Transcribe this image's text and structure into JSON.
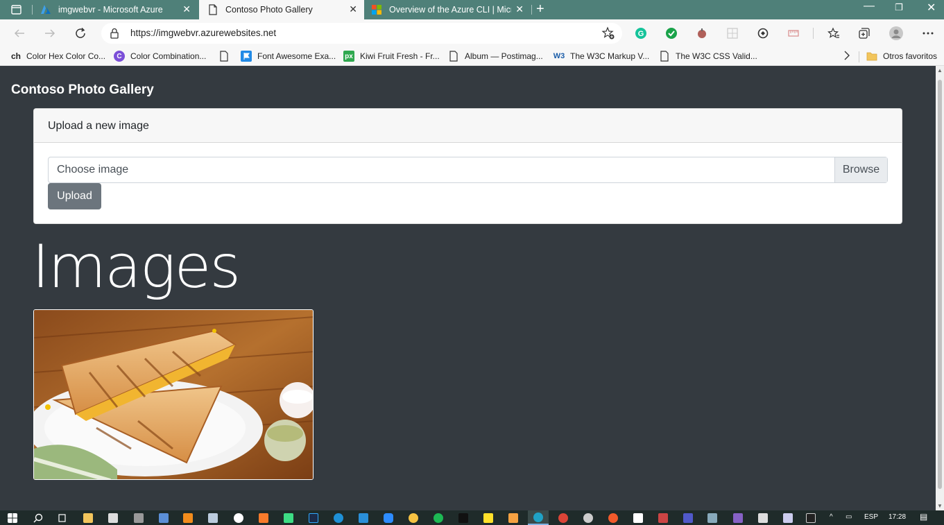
{
  "browser": {
    "tabs": [
      {
        "title": "imgwebvr - Microsoft Azure",
        "active": false
      },
      {
        "title": "Contoso Photo Gallery",
        "active": true
      },
      {
        "title": "Overview of the Azure CLI | Micro",
        "active": false
      }
    ],
    "url": "https://imgwebvr.azurewebsites.net",
    "bookmarks": [
      {
        "icon_text": "ch",
        "label": "Color Hex Color Co..."
      },
      {
        "icon_text": "C",
        "label": "Color Combination..."
      },
      {
        "icon_text": "",
        "label": ""
      },
      {
        "icon_text": "",
        "label": "Font Awesome Exa..."
      },
      {
        "icon_text": "px",
        "label": "Kiwi Fruit Fresh - Fr..."
      },
      {
        "icon_text": "",
        "label": "Album — Postimag..."
      },
      {
        "icon_text": "W3",
        "label": "The W3C Markup V..."
      },
      {
        "icon_text": "",
        "label": "The W3C CSS Valid..."
      }
    ],
    "other_favorites": "Otros favoritos"
  },
  "app": {
    "brand": "Contoso Photo Gallery",
    "upload_card": {
      "header": "Upload a new image",
      "file_placeholder": "Choose image",
      "browse_label": "Browse",
      "upload_label": "Upload"
    },
    "images_heading": "Images"
  },
  "taskbar": {
    "language": "ESP",
    "time": "17:28"
  },
  "colors": {
    "tab_bar": "#4f8079",
    "page_background": "#343a40",
    "upload_button": "#6c757d"
  }
}
